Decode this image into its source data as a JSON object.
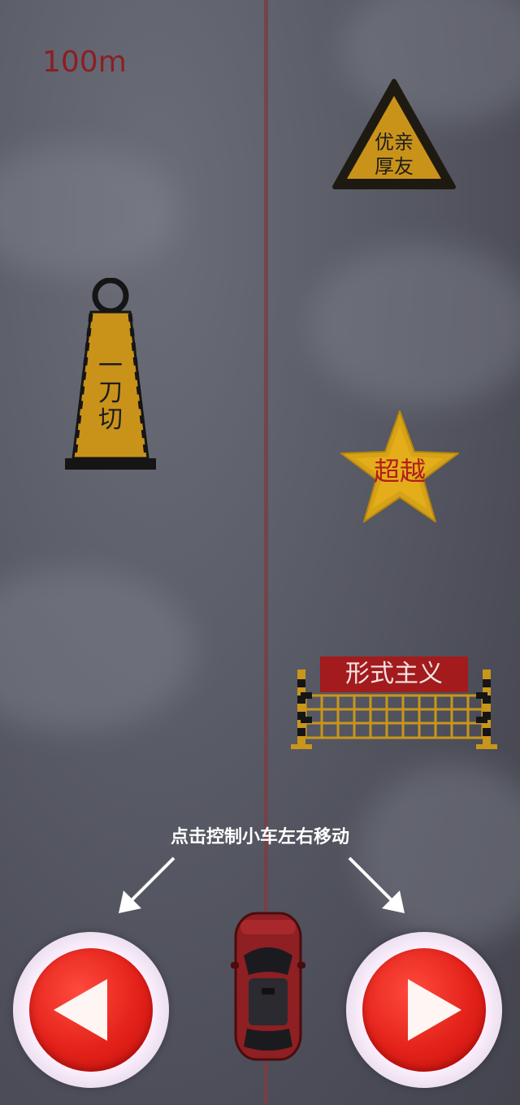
{
  "hud": {
    "distance": "100m"
  },
  "obstacles": {
    "warning_sign": {
      "line1": "优亲",
      "line2": "厚友"
    },
    "traffic_cone": {
      "chars": [
        "一",
        "刀",
        "切"
      ]
    },
    "star": {
      "label": "超越"
    },
    "barrier": {
      "label": "形式主义"
    }
  },
  "hint": {
    "text": "点击控制小车左右移动"
  },
  "controls": {
    "left_icon": "left-triangle-icon",
    "right_icon": "right-triangle-icon"
  },
  "colors": {
    "button_red": "#e3221a",
    "road_line": "#7a3e44",
    "sign_yellow": "#d9a21a",
    "distance_red": "#8b1f24"
  }
}
